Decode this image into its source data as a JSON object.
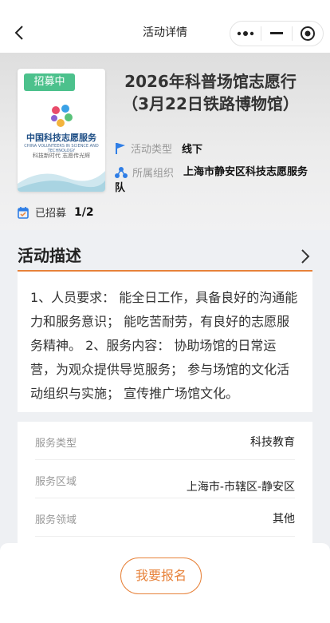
{
  "nav": {
    "title": "活动详情"
  },
  "poster": {
    "badge": "招募中",
    "title": "中国科技志愿服务",
    "subtitle": "CHINA VOLUNTEERS IN SCIENCE AND TECHNOLOGY",
    "slogan": "科技新时代 志愿传光辉"
  },
  "activity": {
    "title": "2026年科普场馆志愿行（3月22日铁路博物馆）",
    "type_label": "活动类型",
    "type_value": "线下",
    "org_label": "所属组织",
    "org_value": "上海市静安区科技志愿服务队",
    "enroll_label": "已招募",
    "enroll_value": "1/2"
  },
  "description": {
    "heading": "活动描述",
    "text": "1、人员要求： 能全日工作，具备良好的沟通能力和服务意识； 能吃苦耐劳，有良好的志愿服务精神。 2、服务内容： 协助场馆的日常运营，为观众提供导览服务； 参与场馆的文化活动组织与实施； 宣传推广场馆文化。"
  },
  "details": [
    {
      "key": "服务类型",
      "value": "科技教育"
    },
    {
      "key": "服务区域",
      "value": "上海市-市辖区-静安区"
    },
    {
      "key": "服务领域",
      "value": "其他"
    }
  ],
  "footer": {
    "join_label": "我要报名"
  },
  "colors": {
    "accent": "#e7823a",
    "badge": "#4cc18c",
    "icon_blue": "#2f7ee6"
  },
  "icons": [
    "back-arrow-icon",
    "more-dots-icon",
    "minimize-icon",
    "close-target-icon",
    "flag-icon",
    "org-nodes-icon",
    "calendar-enroll-icon",
    "chevron-right-icon"
  ]
}
